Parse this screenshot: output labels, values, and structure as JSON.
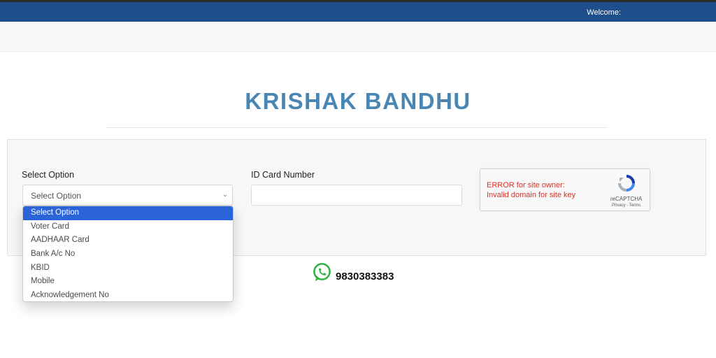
{
  "header": {
    "welcome": "Welcome:"
  },
  "page": {
    "title": "KRISHAK BANDHU"
  },
  "form": {
    "select_label": "Select Option",
    "select_value": "Select Option",
    "id_label": "ID Card Number",
    "dropdown_options": [
      "Select Option",
      "Voter Card",
      "AADHAAR Card",
      "Bank A/c No",
      "KBID",
      "Mobile",
      "Acknowledgement No"
    ]
  },
  "recaptcha": {
    "error_line1": "ERROR for site owner:",
    "error_line2": "Invalid domain for site key",
    "brand": "reCAPTCHA",
    "links": "Privacy - Terms"
  },
  "contact": {
    "phone": "9830383383",
    "icon": "whatsapp-icon"
  },
  "colors": {
    "header_bg": "#1f4e8c",
    "title": "#4a86b3",
    "selected_option": "#2b63d9",
    "whatsapp": "#2fb33f",
    "captcha_error": "#d93025"
  }
}
